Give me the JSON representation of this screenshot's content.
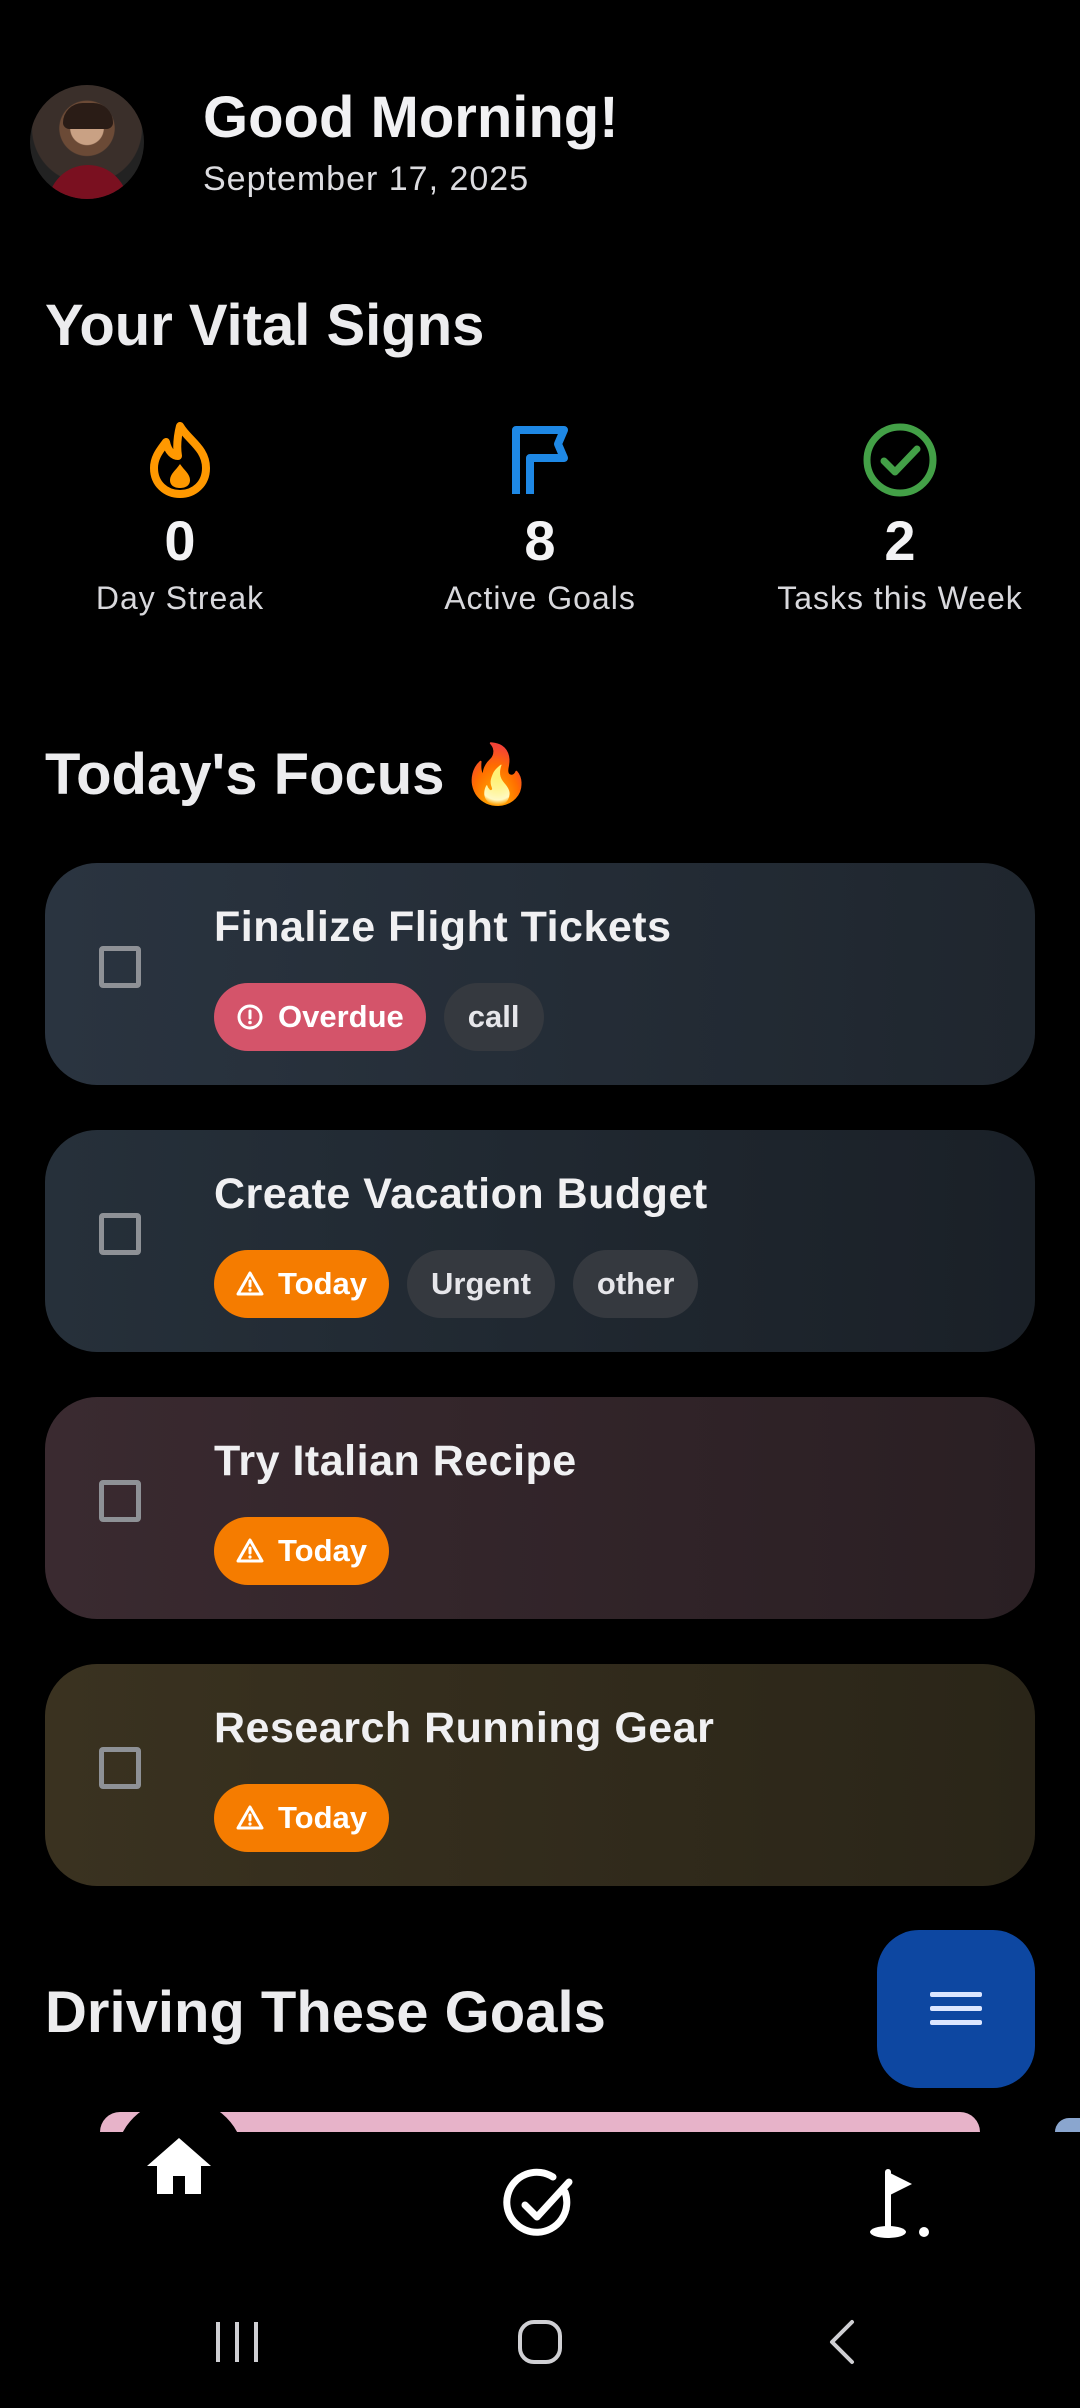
{
  "header": {
    "greeting": "Good Morning!",
    "date": "September 17, 2025"
  },
  "vitals": {
    "title": "Your Vital Signs",
    "items": [
      {
        "value": "0",
        "label": "Day Streak",
        "icon": "flame-icon",
        "color": "#ff9800"
      },
      {
        "value": "8",
        "label": "Active Goals",
        "icon": "flag-icon",
        "color": "#1e88e5"
      },
      {
        "value": "2",
        "label": "Tasks this Week",
        "icon": "check-circle-icon",
        "color": "#43a047"
      }
    ]
  },
  "focus": {
    "title": "Today's Focus 🔥",
    "tasks": [
      {
        "title": "Finalize Flight Tickets",
        "status": "Overdue",
        "tags": [
          "call"
        ]
      },
      {
        "title": "Create Vacation Budget",
        "status": "Today",
        "tags": [
          "Urgent",
          "other"
        ]
      },
      {
        "title": "Try Italian Recipe",
        "status": "Today",
        "tags": []
      },
      {
        "title": "Research Running Gear",
        "status": "Today",
        "tags": []
      }
    ]
  },
  "goals": {
    "title": "Driving These Goals"
  },
  "colors": {
    "overdue": "#d4546a",
    "today": "#f57c00",
    "fab": "#0d47a1"
  },
  "nav": [
    "home-icon",
    "tasks-check-icon",
    "golf-goal-icon"
  ],
  "system_nav": [
    "recents-icon",
    "home-circle-icon",
    "back-icon"
  ]
}
